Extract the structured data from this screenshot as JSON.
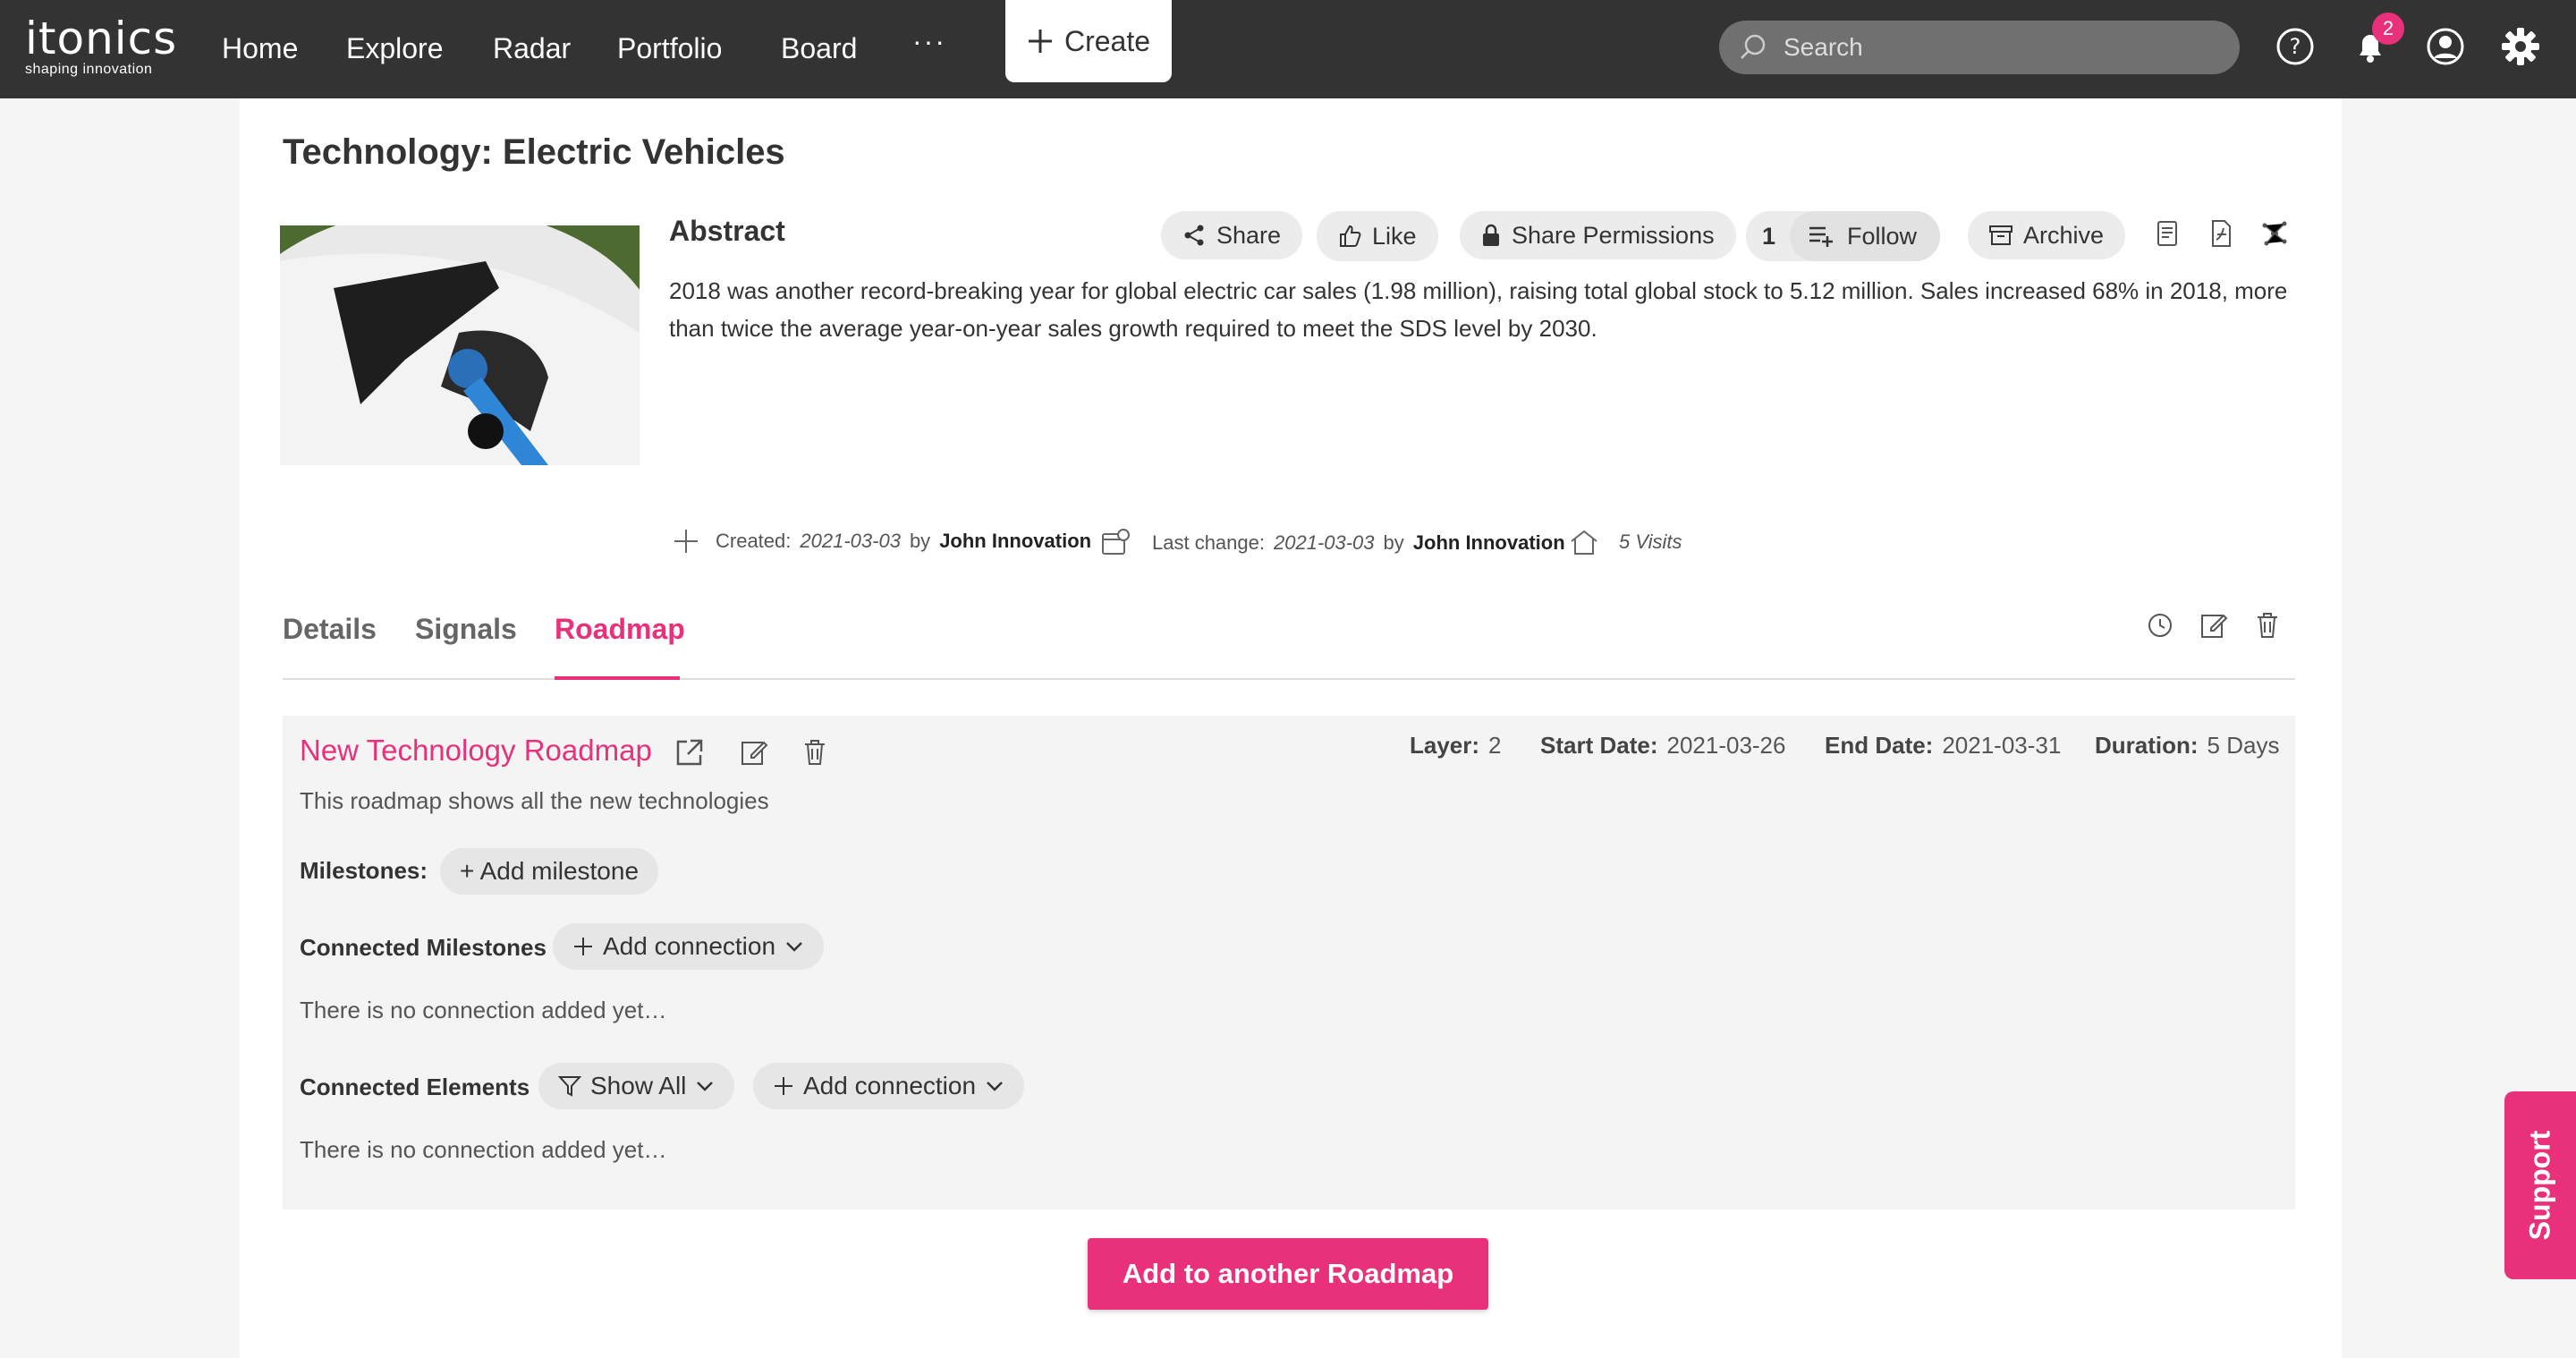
{
  "nav": {
    "logo_word": "itonics",
    "logo_tagline": "shaping innovation",
    "items": [
      "Home",
      "Explore",
      "Radar",
      "Portfolio",
      "Board"
    ],
    "more": "···",
    "create_label": "Create",
    "search_placeholder": "Search",
    "notification_count": "2",
    "icons": [
      "help-icon",
      "bell-icon",
      "user-icon",
      "gear-icon"
    ]
  },
  "page": {
    "title": "Technology: Electric Vehicles"
  },
  "abstract": {
    "heading": "Abstract",
    "text": "2018 was another record-breaking year for global electric car sales (1.98 million), raising total global stock to 5.12 million. Sales increased 68% in 2018, more than twice the average year-on-year sales growth required to meet the SDS level by 2030."
  },
  "actions": {
    "share": "Share",
    "like": "Like",
    "share_permissions": "Share Permissions",
    "follow_count": "1",
    "follow": "Follow",
    "archive": "Archive"
  },
  "meta": {
    "created_label": "Created:",
    "created_date": "2021-03-03",
    "created_by_word": "by",
    "created_by": "John Innovation",
    "changed_label": "Last change:",
    "changed_date": "2021-03-03",
    "changed_by_word": "by",
    "changed_by": "John Innovation",
    "visits": "5 Visits"
  },
  "tabs": [
    "Details",
    "Signals",
    "Roadmap"
  ],
  "roadmap": {
    "title": "New Technology Roadmap",
    "description": "This roadmap shows all the new technologies",
    "layer_label": "Layer:",
    "layer": "2",
    "start_label": "Start Date:",
    "start": "2021-03-26",
    "end_label": "End Date:",
    "end": "2021-03-31",
    "duration_label": "Duration:",
    "duration": "5 Days",
    "milestones_label": "Milestones:",
    "add_milestone": "+ Add milestone",
    "connected_milestones_label": "Connected Milestones",
    "add_connection": "Add connection",
    "no_connection": "There is no connection added yet…",
    "connected_elements_label": "Connected Elements",
    "show_all": "Show All",
    "add_connection_2": "Add connection",
    "no_connection_2": "There is no connection added yet…"
  },
  "add_to_roadmap": "Add to another Roadmap",
  "support": "Support",
  "colors": {
    "accent": "#e8317a",
    "nav_bg": "#333333"
  }
}
